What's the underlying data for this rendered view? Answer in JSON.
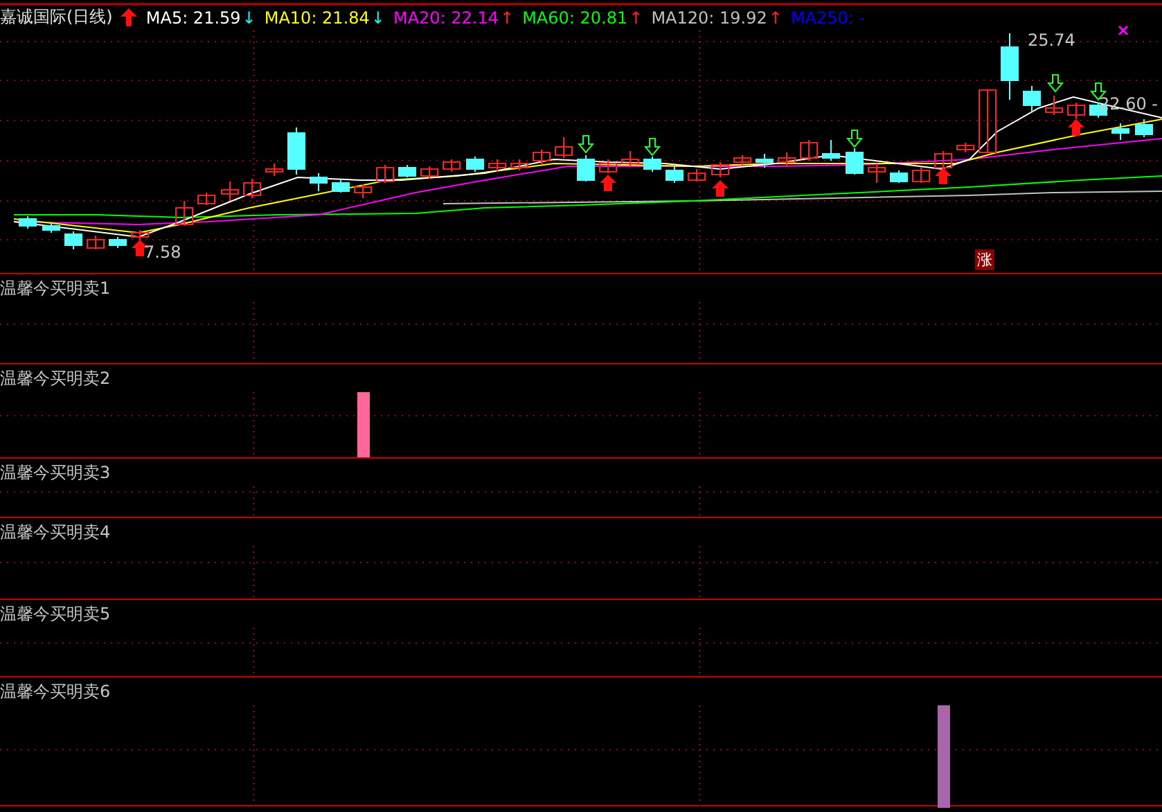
{
  "title": "嘉诚国际(日线)",
  "ma": [
    {
      "kind": "falling",
      "label": "MA5: 21.59",
      "arrow": "↓",
      "color": "#ffffff"
    },
    {
      "kind": "falling",
      "label": "MA10: 21.84",
      "arrow": "↓",
      "color": "#ffff00"
    },
    {
      "kind": "rising",
      "label": "MA20: 22.14",
      "arrow": "↑",
      "color": "#ff00ff"
    },
    {
      "kind": "rising",
      "label": "MA60: 20.81",
      "arrow": "↑",
      "color": "#00ff00"
    },
    {
      "kind": "rising",
      "label": "MA120: 19.92",
      "arrow": "↑",
      "color": "#c0c0c0"
    },
    {
      "kind": "plain",
      "label": "MA250: -",
      "color": "#0000ff"
    }
  ],
  "price_labels": [
    "25.74",
    "22.60 -",
    "7.58"
  ],
  "badge": "涨",
  "panels": [
    {
      "label": "温馨今买明卖1"
    },
    {
      "label": "温馨今买明卖2"
    },
    {
      "label": "温馨今买明卖3"
    },
    {
      "label": "温馨今买明卖4"
    },
    {
      "label": "温馨今买明卖5"
    },
    {
      "label": "温馨今买明卖6"
    }
  ]
}
